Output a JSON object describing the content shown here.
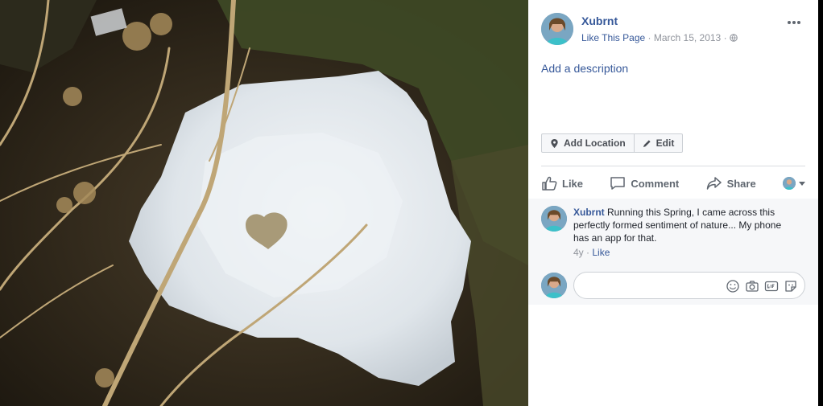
{
  "post": {
    "page_name": "Xubrnt",
    "like_page": "Like This Page",
    "separator": " · ",
    "date": "March 15, 2013",
    "add_description": "Add a description"
  },
  "buttons": {
    "add_location": "Add Location",
    "edit": "Edit"
  },
  "actions": {
    "like": "Like",
    "comment": "Comment",
    "share": "Share"
  },
  "comment": {
    "author": "Xubrnt",
    "text": " Running this Spring, I came across this perfectly formed sentiment of nature... My phone has an app for that.",
    "age": "4y",
    "like": "Like"
  },
  "icons": {
    "more": "more-options-icon",
    "globe": "globe-icon",
    "location": "location-pin-icon",
    "edit": "pencil-icon",
    "like": "thumbs-up-icon",
    "comment": "speech-bubble-icon",
    "share": "share-arrow-icon",
    "emoji": "emoji-icon",
    "camera": "camera-icon",
    "gif": "gif-icon",
    "sticker": "sticker-icon"
  },
  "colors": {
    "link": "#365899",
    "meta": "#90949c",
    "snow": "#e9eef2",
    "grass": "#3f4a26"
  }
}
